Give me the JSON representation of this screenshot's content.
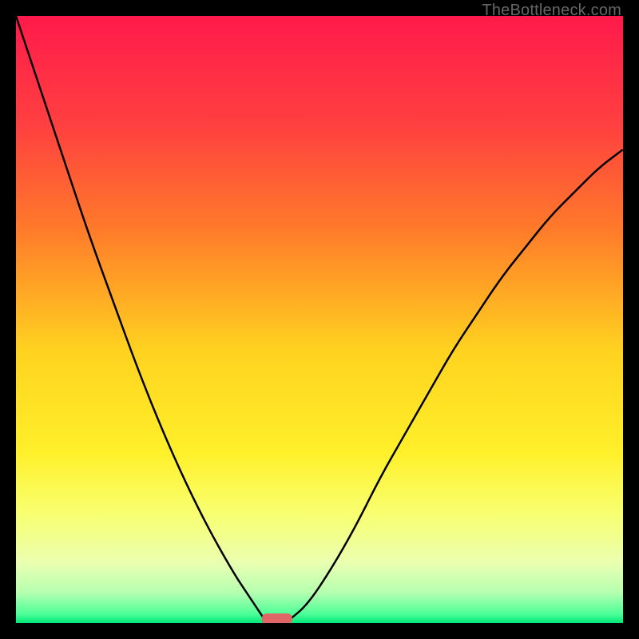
{
  "watermark": "TheBottleneck.com",
  "chart_data": {
    "type": "line",
    "title": "",
    "xlabel": "",
    "ylabel": "",
    "xlim": [
      0,
      100
    ],
    "ylim": [
      0,
      100
    ],
    "grid": false,
    "legend": false,
    "background_gradient": {
      "stops": [
        {
          "offset": 0.0,
          "color": "#ff1a4b"
        },
        {
          "offset": 0.18,
          "color": "#ff4040"
        },
        {
          "offset": 0.35,
          "color": "#ff7a2a"
        },
        {
          "offset": 0.55,
          "color": "#ffd21f"
        },
        {
          "offset": 0.72,
          "color": "#fff02a"
        },
        {
          "offset": 0.82,
          "color": "#f8ff70"
        },
        {
          "offset": 0.9,
          "color": "#eaffb0"
        },
        {
          "offset": 0.95,
          "color": "#b6ffb0"
        },
        {
          "offset": 0.985,
          "color": "#4dff98"
        },
        {
          "offset": 1.0,
          "color": "#00e878"
        }
      ]
    },
    "series": [
      {
        "name": "left-curve",
        "x": [
          0,
          4,
          8,
          12,
          16,
          20,
          24,
          28,
          32,
          36,
          38,
          40,
          41
        ],
        "y": [
          100,
          88,
          76,
          64,
          53,
          42,
          32,
          23,
          15,
          8,
          5,
          2,
          0.5
        ]
      },
      {
        "name": "right-curve",
        "x": [
          45,
          48,
          52,
          56,
          60,
          64,
          68,
          72,
          76,
          80,
          84,
          88,
          92,
          96,
          100
        ],
        "y": [
          0.5,
          3,
          9,
          16,
          24,
          31,
          38,
          45,
          51,
          57,
          62,
          67,
          71,
          75,
          78
        ]
      }
    ],
    "marker": {
      "name": "bottleneck-marker",
      "x_center": 43,
      "width": 5,
      "color": "#e06666"
    }
  }
}
